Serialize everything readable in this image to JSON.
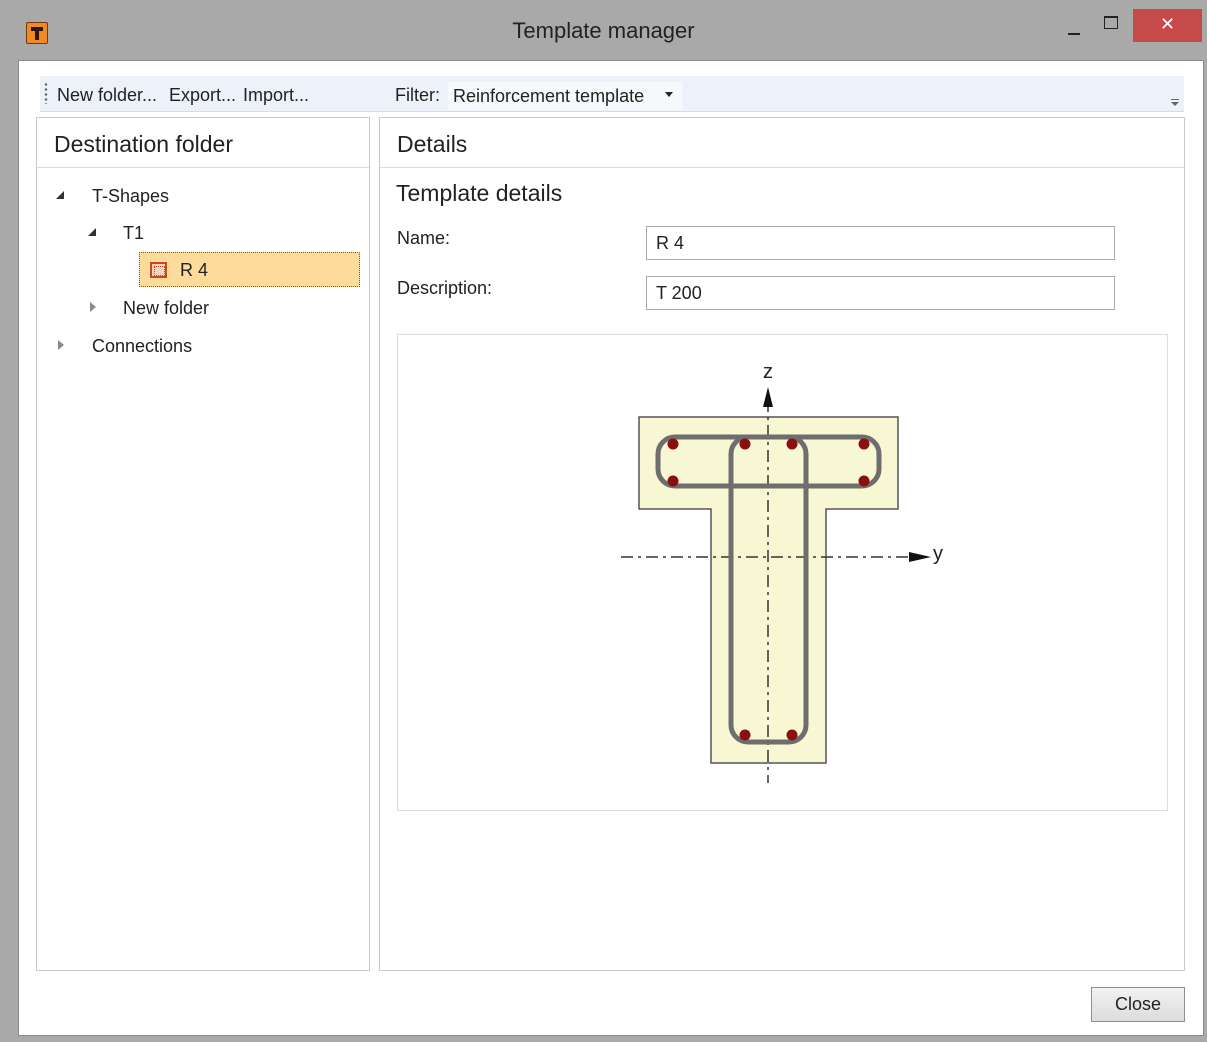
{
  "window": {
    "title": "Template manager",
    "close_glyph": "✕"
  },
  "toolbar": {
    "new_folder": "New folder...",
    "export": "Export...",
    "import": "Import...",
    "filter_label": "Filter:",
    "filter_value": "Reinforcement template"
  },
  "left_panel": {
    "title": "Destination folder",
    "tree": {
      "root1": "T-Shapes",
      "child1": "T1",
      "selected_item": "R 4",
      "child2": "New folder",
      "root2": "Connections"
    }
  },
  "right_panel": {
    "title": "Details",
    "subtitle": "Template details",
    "name_label": "Name:",
    "name_value": "R 4",
    "description_label": "Description:",
    "description_value": "T 200"
  },
  "preview": {
    "axis_z": "z",
    "axis_y": "y",
    "section_fill": "#f7f7d4",
    "rebar_color": "#8a0f0f",
    "stirrup_color": "#6e6e6e"
  },
  "footer": {
    "close_label": "Close"
  }
}
